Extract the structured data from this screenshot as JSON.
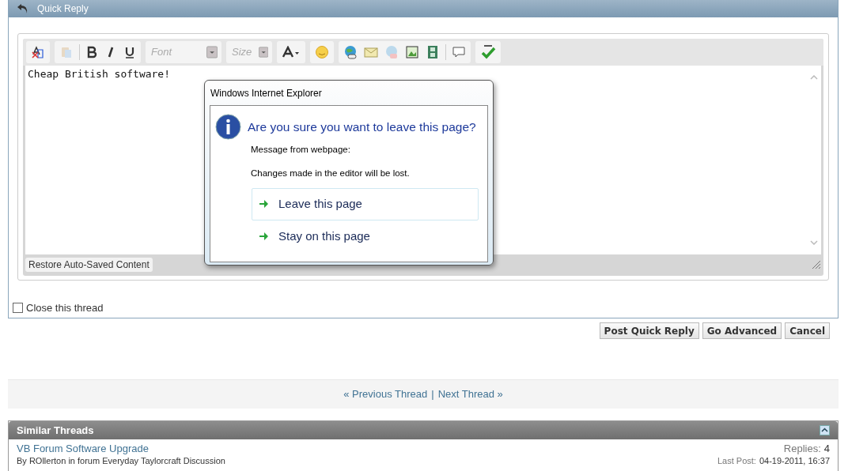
{
  "panel": {
    "title": "Quick Reply"
  },
  "toolbar": [
    [
      {
        "kind": "icon"
      }
    ],
    [
      {
        "kind": "icon"
      },
      {
        "kind": "icon"
      },
      {
        "kind": "icon"
      },
      {
        "kind": "icon"
      }
    ],
    [
      {
        "kind": "select",
        "placeholder": "Font"
      }
    ],
    [
      {
        "kind": "select",
        "placeholder": "Size"
      }
    ],
    [
      {
        "kind": "icon"
      }
    ],
    [
      {
        "kind": "icon"
      }
    ],
    [
      {
        "kind": "icon"
      },
      {
        "kind": "icon"
      },
      {
        "kind": "icon"
      },
      {
        "kind": "icon"
      },
      {
        "kind": "icon"
      },
      {
        "kind": "icon"
      }
    ],
    [
      {
        "kind": "icon"
      }
    ]
  ],
  "editor": {
    "value": "Cheap British software!",
    "restore_button": "Restore Auto-Saved Content"
  },
  "close_thread": {
    "label": "Close this thread",
    "checked": false
  },
  "buttons": [
    "Post Quick Reply",
    "Go Advanced",
    "Cancel"
  ],
  "thread_nav": {
    "previous": "« Previous Thread",
    "separator": "|",
    "next": "Next Thread »"
  },
  "similar_threads": {
    "title": "Similar Threads",
    "rows": [
      {
        "title": "VB Forum Software Upgrade",
        "byline": "By ROllerton in forum Everyday Taylorcraft Discussion",
        "replies_label": "Replies:",
        "replies": "4",
        "last_post_label": "Last Post:",
        "last_post": "04-19-2011, 16:37"
      }
    ]
  },
  "dialog": {
    "title": "Windows Internet Explorer",
    "heading": "Are you sure you want to leave this page?",
    "lines": [
      "Message from webpage:",
      "Changes made in the editor will be lost."
    ],
    "options": [
      {
        "label": "Leave this page",
        "selected": true
      },
      {
        "label": "Stay on this page",
        "selected": false
      }
    ]
  }
}
